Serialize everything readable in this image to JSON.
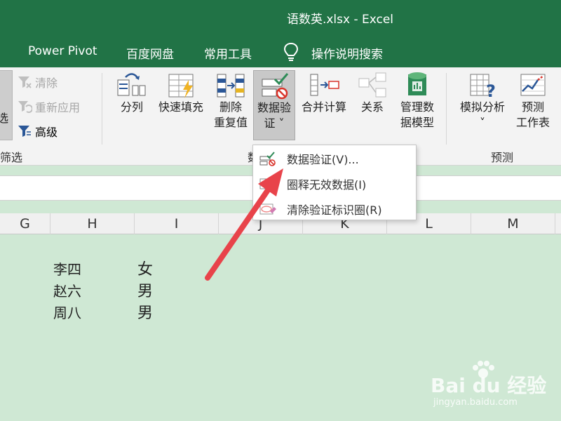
{
  "window": {
    "title": "语数英.xlsx  -  Excel"
  },
  "menubar": {
    "items": [
      "Power Pivot",
      "百度网盘",
      "常用工具"
    ],
    "tell_me": "操作说明搜索"
  },
  "ribbon": {
    "filter_group": {
      "left_button_partial": "选",
      "clear": "清除",
      "reapply": "重新应用",
      "advanced": "高级",
      "label": "筛选"
    },
    "data_tools": {
      "split": "分列",
      "flash_fill": "快速填充",
      "remove_dup_line1": "删除",
      "remove_dup_line2": "重复值",
      "validation_line1": "数据验",
      "validation_line2": "证 ˅",
      "consolidate": "合并计算",
      "relations": "关系",
      "manage_model_line1": "管理数",
      "manage_model_line2": "据模型",
      "label_partial": "数"
    },
    "forecast": {
      "whatif_line1": "模拟分析",
      "whatif_line2": "˅",
      "sheet_line1": "预测",
      "sheet_line2": "工作表",
      "label": "预测"
    }
  },
  "dropdown": {
    "items": [
      "数据验证(V)...",
      "圈释无效数据(I)",
      "清除验证标识圈(R)"
    ]
  },
  "columns": [
    "G",
    "H",
    "I",
    "J",
    "K",
    "L",
    "M"
  ],
  "cells": {
    "names": [
      "李四",
      "赵六",
      "周八"
    ],
    "genders": [
      "女",
      "男",
      "男"
    ]
  },
  "watermark": {
    "brand": "Bai du 经验",
    "url": "jingyan.baidu.com"
  },
  "colors": {
    "excel_green": "#217346",
    "sheet_bg": "#cfe8d4",
    "arrow": "#e8434a"
  }
}
